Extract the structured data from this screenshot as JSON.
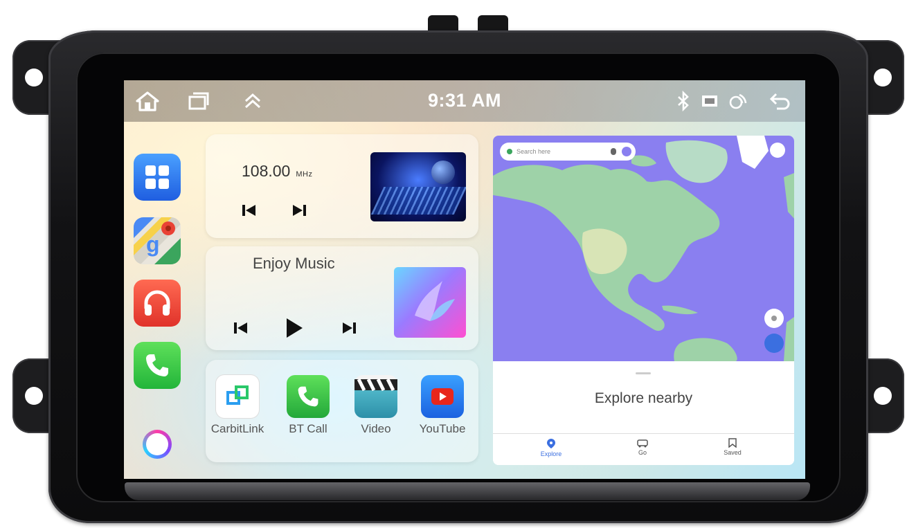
{
  "status_bar": {
    "time": "9:31 AM"
  },
  "radio": {
    "frequency": "108.00",
    "unit": "MHz"
  },
  "music": {
    "title": "Enjoy Music"
  },
  "apps": [
    {
      "label": "CarbitLink",
      "icon": "carbitlink-icon"
    },
    {
      "label": "BT Call",
      "icon": "phone-icon"
    },
    {
      "label": "Video",
      "icon": "clapperboard-icon"
    },
    {
      "label": "YouTube",
      "icon": "youtube-icon"
    }
  ],
  "map": {
    "search_placeholder": "Search here",
    "explore_label": "Explore nearby",
    "nav": [
      {
        "label": "Explore",
        "active": true
      },
      {
        "label": "Go",
        "active": false
      },
      {
        "label": "Saved",
        "active": false
      }
    ]
  },
  "colors": {
    "map_water": "#8a7ff0",
    "accent_blue": "#3b6fe0"
  }
}
